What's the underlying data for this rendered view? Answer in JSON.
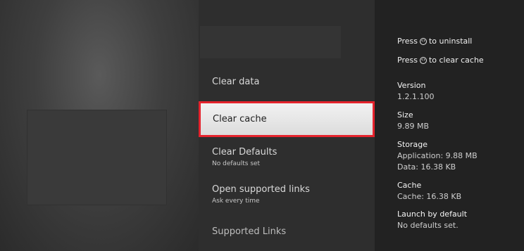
{
  "menu": {
    "items": [
      {
        "title": "Clear data",
        "subtitle": ""
      },
      {
        "title": "Clear cache",
        "subtitle": "",
        "selected": true
      },
      {
        "title": "Clear Defaults",
        "subtitle": "No defaults set"
      },
      {
        "title": "Open supported links",
        "subtitle": "Ask every time"
      },
      {
        "title": "Supported Links",
        "subtitle": ""
      }
    ]
  },
  "hints": {
    "uninstall_prefix": "Press",
    "uninstall_suffix": "to uninstall",
    "clear_cache_prefix": "Press",
    "clear_cache_suffix": "to clear cache",
    "icon": "play-pause-icon"
  },
  "info": {
    "version_label": "Version",
    "version_value": "1.2.1.100",
    "size_label": "Size",
    "size_value": "9.89 MB",
    "storage_label": "Storage",
    "storage_application": "Application: 9.88 MB",
    "storage_data": "Data: 16.38 KB",
    "cache_label": "Cache",
    "cache_value": "Cache: 16.38 KB",
    "launch_label": "Launch by default",
    "launch_value": "No defaults set."
  },
  "colors": {
    "highlight_border": "#e5232d",
    "selected_background": "#e8e8e8"
  }
}
